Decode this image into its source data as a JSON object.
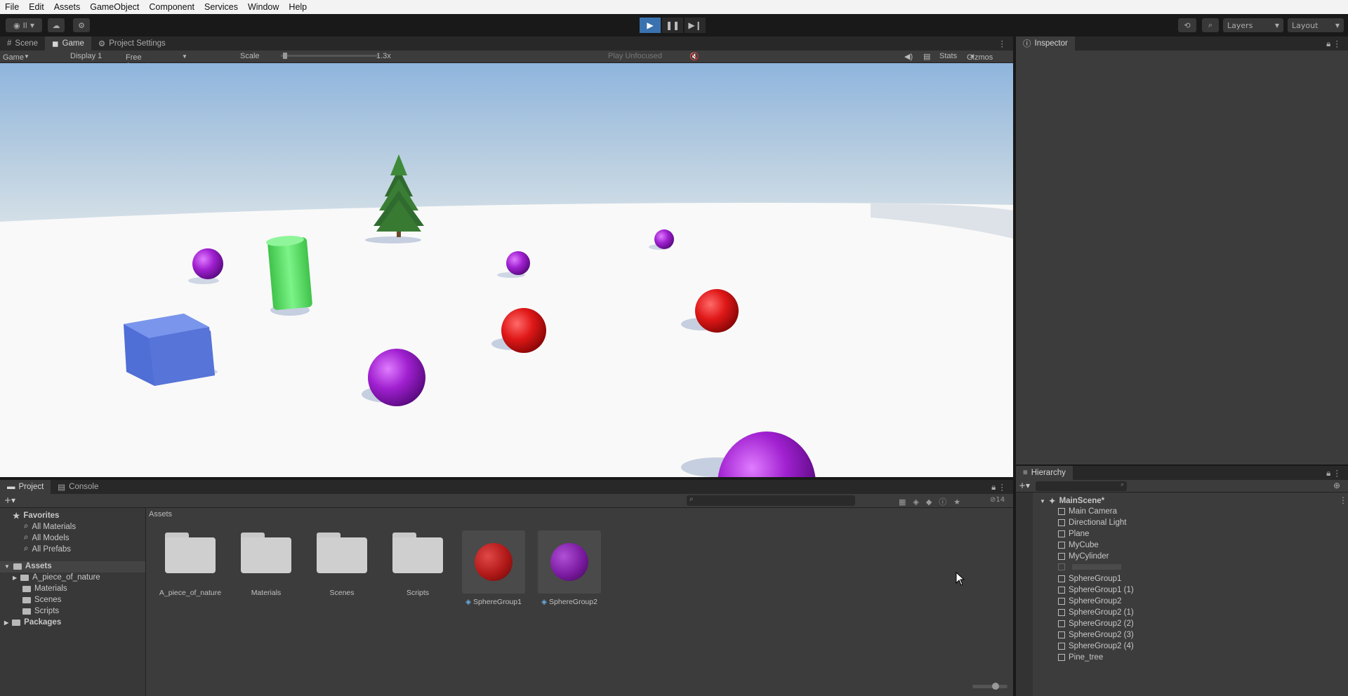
{
  "menu": [
    "File",
    "Edit",
    "Assets",
    "GameObject",
    "Component",
    "Services",
    "Window",
    "Help"
  ],
  "toolbar": {
    "account_label": "Il",
    "play_icons": [
      "play-icon",
      "pause-icon",
      "step-icon"
    ],
    "layers_label": "Layers",
    "layout_label": "Layout"
  },
  "game_panel": {
    "tabs": [
      {
        "label": "Scene",
        "icon": "scene-icon"
      },
      {
        "label": "Game",
        "icon": "game-icon"
      },
      {
        "label": "Project Settings",
        "icon": "gear-icon"
      }
    ],
    "toolbar": {
      "mode": "Game",
      "display": "Display 1",
      "aspect": "Free Aspect",
      "scale_label": "Scale",
      "scale_value": "1.3x",
      "play_mode": "Play Unfocused",
      "stats": "Stats",
      "gizmos": "Gizmos"
    },
    "colors": {
      "sky_top": "#8fb5dd",
      "horizon": "#d3dde5",
      "ground": "#f9f9f9",
      "red": "#e01818",
      "purple": "#a020d0",
      "green": "#55e060",
      "blue": "#5a78e0"
    }
  },
  "inspector": {
    "tab": "Inspector"
  },
  "project": {
    "tabs": [
      {
        "label": "Project",
        "icon": "folder-icon"
      },
      {
        "label": "Console",
        "icon": "console-icon"
      }
    ],
    "favorites_label": "Favorites",
    "favorites": [
      "All Materials",
      "All Models",
      "All Prefabs"
    ],
    "assets_label": "Assets",
    "asset_folders": [
      "A_piece_of_nature",
      "Materials",
      "Scenes",
      "Scripts"
    ],
    "packages_label": "Packages",
    "breadcrumb": "Assets",
    "tiles": [
      {
        "label": "A_piece_of_nature",
        "kind": "folder"
      },
      {
        "label": "Materials",
        "kind": "folder"
      },
      {
        "label": "Scenes",
        "kind": "folder"
      },
      {
        "label": "Scripts",
        "kind": "folder"
      },
      {
        "label": "SphereGroup1",
        "kind": "prefab",
        "color": "#b01818"
      },
      {
        "label": "SphereGroup2",
        "kind": "prefab",
        "color": "#7a1aa0"
      }
    ],
    "hidden_count": "14"
  },
  "hierarchy": {
    "tab": "Hierarchy",
    "scene": "MainScene*",
    "items": [
      "Main Camera",
      "Directional Light",
      "Plane",
      "MyCube",
      "MyCylinder",
      "",
      "SphereGroup1",
      "SphereGroup1 (1)",
      "SphereGroup2",
      "SphereGroup2 (1)",
      "SphereGroup2 (2)",
      "SphereGroup2 (3)",
      "SphereGroup2 (4)",
      "Pine_tree"
    ]
  }
}
